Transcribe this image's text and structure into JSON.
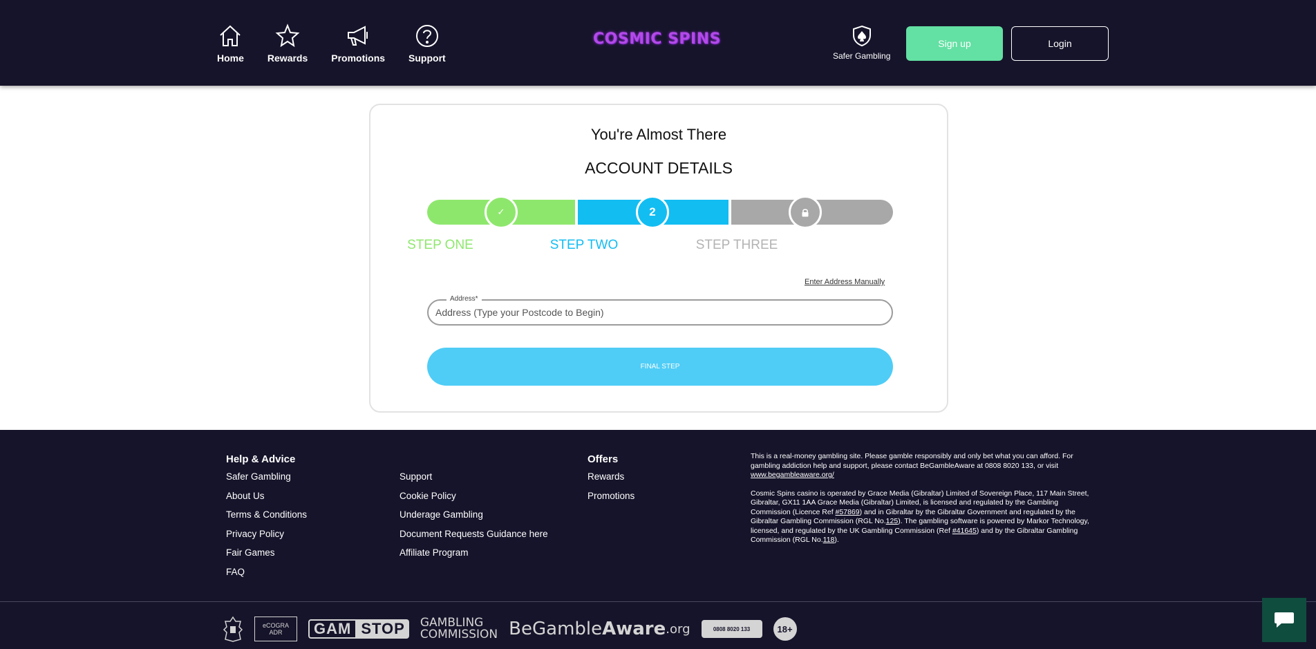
{
  "header": {
    "nav": [
      {
        "label": "Home",
        "icon": "home-icon"
      },
      {
        "label": "Rewards",
        "icon": "star-icon"
      },
      {
        "label": "Promotions",
        "icon": "megaphone-icon"
      },
      {
        "label": "Support",
        "icon": "question-icon"
      }
    ],
    "logo_text": "COSMIC SPINS",
    "safer_gambling_label": "Safer Gambling",
    "signup_label": "Sign up",
    "login_label": "Login"
  },
  "form": {
    "heading": "You're Almost There",
    "subheading": "ACCOUNT DETAILS",
    "steps": [
      {
        "label": "STEP ONE",
        "marker": "✓",
        "state": "complete",
        "color": "#8ee76d"
      },
      {
        "label": "STEP TWO",
        "marker": "2",
        "state": "current",
        "color": "#12bdf2"
      },
      {
        "label": "STEP THREE",
        "marker": "lock-icon",
        "state": "locked",
        "color": "#a8a8a8"
      }
    ],
    "manual_link": "Enter Address Manually",
    "address_label": "Address*",
    "address_placeholder": "Address (Type your Postcode to Begin)",
    "address_value": "",
    "submit_label": "FINAL STEP"
  },
  "footer": {
    "col1_heading": "Help & Advice",
    "col1_links": [
      "Safer Gambling",
      "About Us",
      "Terms & Conditions",
      "Privacy Policy",
      "Fair Games",
      "FAQ"
    ],
    "col2_links": [
      "Support",
      "Cookie Policy",
      "Underage Gambling",
      "Document Requests Guidance here",
      "Affiliate Program"
    ],
    "col3_heading": "Offers",
    "col3_links": [
      "Rewards",
      "Promotions"
    ],
    "legal_p1": "This is a real-money gambling site. Please gamble responsibly and only bet what you can afford. For gambling addiction help and support, please contact BeGambleAware at 0808 8020 133, or visit ",
    "legal_p1_link": "www.begambleaware.org/",
    "legal_p2_a": "Cosmic Spins casino is operated by Grace Media (Gibraltar) Limited of Sovereign Place, 117 Main Street, Gibraltar, GX11 1AA Grace Media (Gibraltar) Limited, is licensed and regulated by the Gambling Commission (Licence Ref ",
    "legal_p2_link1": "#57869",
    "legal_p2_b": ") and in Gibraltar by the Gibraltar Government and regulated by the Gibraltar Gambling Commission (RGL No.",
    "legal_p2_link2": "125",
    "legal_p2_c": "). The gambling software is powered by Markor Technology, licensed, and regulated by the UK Gambling Commission (Ref ",
    "legal_p2_link3": "#41645",
    "legal_p2_d": ") and by the Gibraltar Gambling Commission (RGL No.",
    "legal_p2_link4": "118",
    "legal_p2_e": ").",
    "badges": {
      "ecogra_top": "eCOGRA",
      "ecogra_bottom": "ADR",
      "gamstop_a": "GAM",
      "gamstop_b": "STOP",
      "gc_line1": "GAMBLING",
      "gc_line2": "COMMISSION",
      "bga_a": "Be",
      "bga_b": "Gamble",
      "bga_c": "Aware",
      "bga_d": ".org",
      "helpline": "0808 8020 133",
      "age": "18+"
    }
  },
  "colors": {
    "header_bg": "#16142a",
    "signup_bg": "#63e0a3",
    "step_complete": "#8ee76d",
    "step_current": "#12bdf2",
    "step_locked": "#a8a8a8",
    "submit_bg": "#4fcdf6",
    "chat_bg": "#0f4d3f"
  }
}
